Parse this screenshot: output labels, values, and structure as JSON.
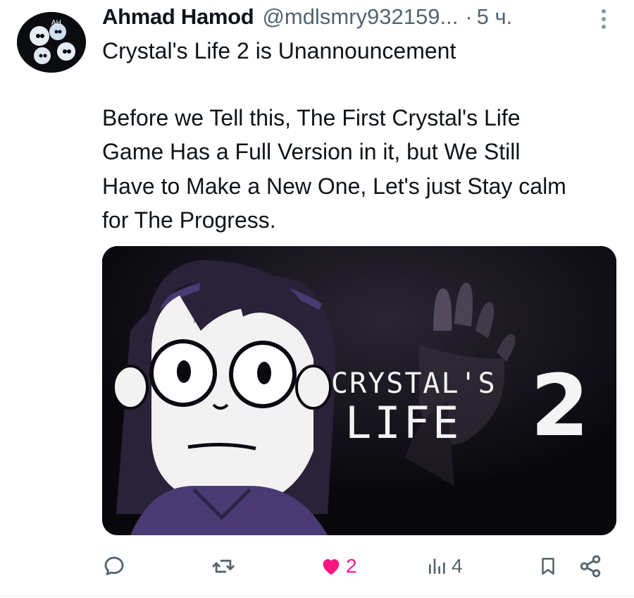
{
  "tweet": {
    "author_name": "Ahmad Hamod",
    "author_handle": "@mdlsmry932159...",
    "separator": "·",
    "timestamp": "5 ч.",
    "avatar_text": "AH",
    "text_lines": [
      "Crystal's Life 2 is Unannouncement",
      "Before we Tell this, The First Crystal's Life",
      "Game Has a Full Version in it, but We Still",
      "Have to Make a New One, Let's just Stay calm",
      "for The Progress."
    ]
  },
  "media": {
    "title_line1": "CRYSTAL'S",
    "title_line2": "LIFE",
    "title_number": "2",
    "colors": {
      "background": "#08080c",
      "character_hair": "#2a2238",
      "shirt": "#4a3a73"
    }
  },
  "actions": {
    "reply_icon": "reply-icon",
    "repost_icon": "repost-icon",
    "like_icon": "heart-filled-icon",
    "like_count": "2",
    "views_icon": "views-chart-icon",
    "views_count": "4",
    "bookmark_icon": "bookmark-icon",
    "share_icon": "share-icon"
  },
  "colors": {
    "secondary_text": "#536471",
    "like": "#f91880",
    "primary_text": "#0f1419"
  }
}
